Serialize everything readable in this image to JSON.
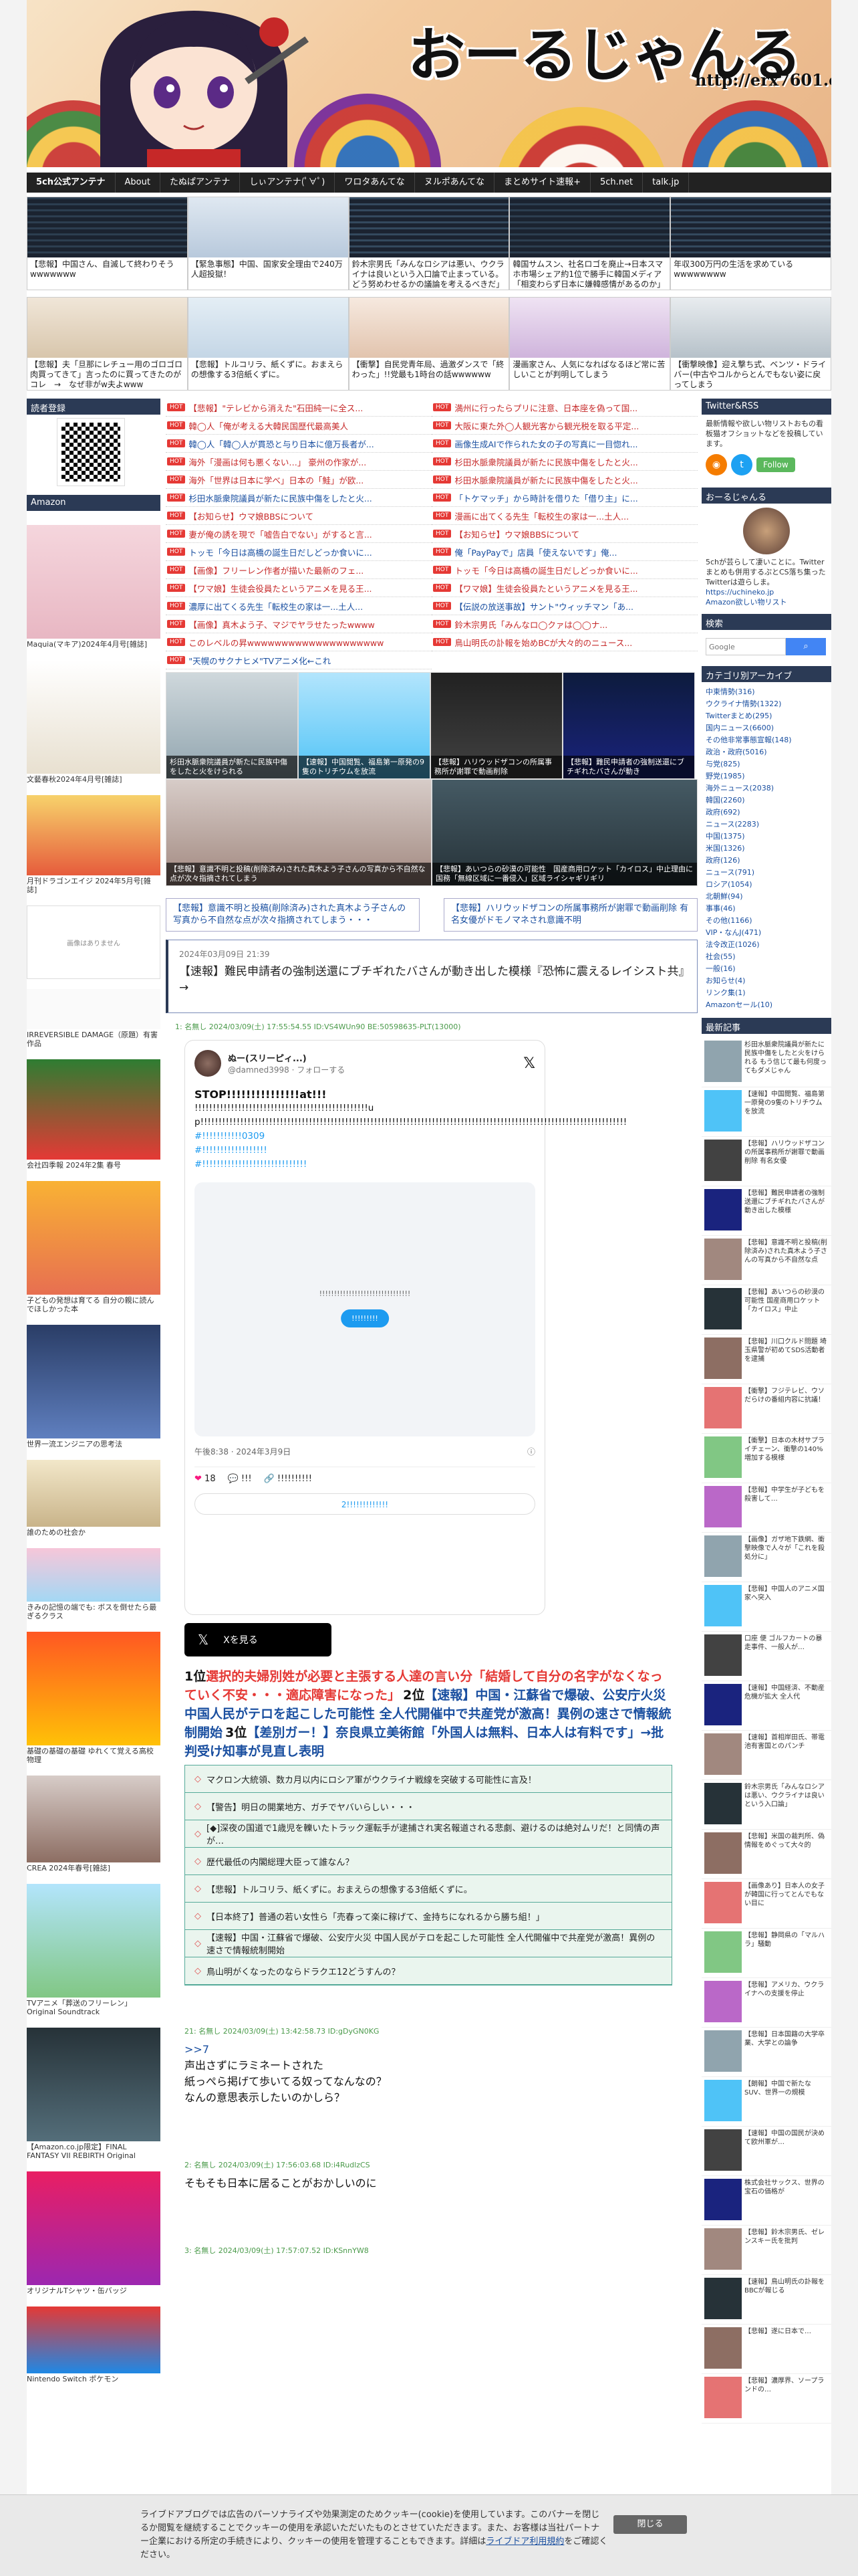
{
  "site": {
    "title": "おーるじゃんる",
    "url": "http://erx7601.com"
  },
  "nav": [
    "5ch公式アンテナ",
    "About",
    "たぬぱアンテナ",
    "しぃアンテナ(ﾟ∀ﾟ)",
    "ワロタあんてな",
    "ヌルポあんてな",
    "まとめサイト速報+",
    "5ch.net",
    "talk.jp"
  ],
  "top_thumbs": [
    "【悲報】中国さん、自滅して終わりそうwwwwwww",
    "【緊急事態】中国、国家安全理由で240万人超投獄！",
    "鈴木宗男氏「みんなロシアは悪い、ウクライナは良いという入口論で止まっている。どう努めわせるかの議論を考えるべきだ」",
    "韓国サムスン、社名ロゴを廃止→日本スマホ市場シェア約1位で勝手に韓国メディア「相変わらず日本に嫌韓感情があるのか」",
    "年収300万円の生活を求めているwwwwwwww",
    "【悲報】夫「旦那にレチュー用のゴロゴロ肉買ってきて」言ったのに買ってきたのがコレ　→　なぜ非がw夫よwww",
    "【悲報】トルコリラ、紙くずに。おまえらの想像する3倍紙くずに。",
    "【衝撃】自民党青年局、過激ダンスで「終わった」!!党最も1時台の話wwwwww",
    "漫画家さん、人気になればなるほど常に苦しいことが判明してしまう",
    "【衝撃映像】迎え撃ち式、ベンツ・ドライバー(中古やコルからとんでもない姿に戻ってしまう"
  ],
  "left": {
    "reader_title": "読者登録",
    "amazon_title": "Amazon",
    "ads": [
      "Maquia(マキア)2024年4月号[雑誌]",
      "文藝春秋2024年4月号[雑誌]",
      "月刊ドラゴンエイジ 2024年5月号[雑誌]",
      "画像はありません",
      "IRREVERSIBLE DAMAGE（原題）有害作品",
      "会社四季報 2024年2集 春号",
      "子どもの発想は育てる 自分の親に読んでほしかった本",
      "世界一流エンジニアの思考法",
      "誰のための社会か",
      "きみの記憶の端でも: ボスを倒せたら最ぎるクラス",
      "基礎の基礎の基礎 ゆれくて覚える高校物理",
      "CREA 2024年春号[雑誌]",
      "TVアニメ「葬送のフリーレン」Original Soundtrack",
      "【Amazon.co.jp限定】FINAL FANTASY VII REBIRTH Original",
      "オリジナルTシャツ・缶バッジ",
      "Nintendo Switch ポケモン"
    ]
  },
  "headlines_left": [
    "【悲報】\"テレビから消えた\"石田純一に全ス...",
    "韓◯人「俺が考える大韓民国歴代最高美人",
    "韓◯人「韓◯人が貫恐と与り日本に億万長者が...",
    "海外「漫画は何も悪くない…」 豪州の作家が...",
    "海外「世界は日本に学べ」日本の「鮭」が欧...",
    "杉田水脈衆院議員が新たに民族中傷をしたと火...",
    "【お知らせ】ウマ娘BBSについて",
    "妻が俺の誘を現で「嘘告白でない」がすると言...",
    "トッモ「今日は高橋の誕生日だしどっか食いに...",
    "【画像】フリーレン作者が描いた最新のフェ...",
    "【ワマ娘】生徒会役員たというアニメを見る王...",
    "濃厚に出てくる先生「転校生の家は一...土人...",
    "【画像】真木よう子、マジでヤラせたったwwww",
    "このレベルの昇wwwwwwwwwwwwwwwwwwww",
    "\"天幌のサクナヒメ\"TVアニメ化←これ"
  ],
  "headlines_right": [
    "満州に行ったらプリに注意、日本座を偽って国...",
    "大阪に東た外◯人観光客から観光税を取る平定...",
    "画像生成AIで作られた女の子の写真に一目惚れ...",
    "杉田水脈衆院議員が新たに民族中傷をしたと火...",
    "杉田水脈衆院議員が新たに民族中傷をしたと火...",
    "「トケマッチ」から時計を借りた「借り主」に...",
    "漫画に出てくる先生「転校生の家は一...土人...",
    "【お知らせ】ウマ娘BBSについて",
    "俺「PayPayで」店員「使えないです」俺...",
    "トッモ「今日は高橋の誕生日だしどっか食いに...",
    "【ワマ娘】生徒会役員たというアニメを見る王...",
    "【伝説の放送事故】サント\"ウィッチマン「あ...",
    "鈴木宗男氏「みんなロ◯クァは◯◯ナ...",
    "鳥山明氏の訃報を始めBCが大々的のニュース..."
  ],
  "photo_grid": [
    "杉田水脈衆院議員が新たに民族中傷をしたと火をけられる",
    "【速報】中国閲覧、福島第一原発の9隻のトリチウムを放流",
    "【悲報】ハリウッドザコンの所属事務所が謝罪で動画削除",
    "【悲報】難民申請者の強制送還にブチギれたバさんが動き",
    "【悲報】意識不明と投稿(削除済み)された真木よう子さんの写真から不自然な点が次々指摘されてしまう",
    "【悲報】あいつらの砂漠の可能性　国産商用ロケット「カイロス」中止理由に国務「無線区域に一番侵入」区域ライシャギリギリ"
  ],
  "prev_next": {
    "prev": "【悲報】意識不明と投稿(削除済み)された真木よう子さんの写真から不自然な点が次々指摘されてしまう・・・",
    "next": "【悲報】ハリウッドザコンの所属事務所が謝罪で動画削除 有名女優がドモノマネされ意識不明"
  },
  "article": {
    "date": "2024年03月09日 21:39",
    "title": "【速報】難民申請者の強制送還にブチギれたバさんが動き出した模様『恐怖に震えるレイシスト共』→"
  },
  "post1": {
    "head": "1: 名無し 2024/03/09(土) 17:55:54.55 ID:VS4WUn90 BE:50598635-PLT(13000)",
    "tweet_name": "ぬー(スリーピィ...)",
    "tweet_handle": "@damned3998 · フォローする",
    "tweet_title": "STOP!!!!!!!!!!!!!!!at!!!",
    "tweet_body": "!!!!!!!!!!!!!!!!!!!!!!!!!!!!!!!!!!!!!!!!!!!!!!!!up!!!!!!!!!!!!!!!!!!!!!!!!!!!!!!!!!!!!!!!!!!!!!!!!!!!!!!!!!!!!!!!!!!!!!!!!!!!!!!!!!!!!!!!!!!!!!!!!!!!!!!!!!!!!!!!!!!!!!!",
    "hashtags": [
      "#!!!!!!!!!!!0309",
      "#!!!!!!!!!!!!!!!!!!",
      "#!!!!!!!!!!!!!!!!!!!!!!!!!!!!!"
    ],
    "media_msg": "!!!!!!!!!!!!!!!!!!!!!!!!!!!!!!!",
    "media_btn": "!!!!!!!!!",
    "tweet_time": "午後8:38 · 2024年3月9日",
    "likes": "18",
    "reply_label": "!!!",
    "link_label": "!!!!!!!!!!",
    "read_more": "2!!!!!!!!!!!!!",
    "x_btn": "Xを見る"
  },
  "ranking": [
    {
      "no": "1位",
      "text": "選択的夫婦別姓が必要と主張する人達の言い分「結婚して自分の名字がなくなっていく不安・・・適応障害になった」"
    },
    {
      "no": "2位",
      "text": "【速報】中国・江蘇省で爆破、公安庁火災 中国人民がテロを起こした可能性 全人代開催中で共産党が激高！異例の速さで情報統制開始"
    },
    {
      "no": "3位",
      "text": "【差別ガー！】奈良県立美術館「外国人は無料、日本人は有料です」→批判受け知事が見直し表明"
    }
  ],
  "linklist": [
    "マクロン大統領、数カ月以内にロシア軍がウクライナ戦線を突破する可能性に言及！",
    "【警告】明日の開業地方、ガチでヤバいらしい・・・",
    "[◆]深夜の国道で1歳児を轢いたトラック運転手が逮捕され実名報道される悲劇、避けるのは絶対ムリだ！と同情の声が…",
    "歴代最低の内閣総理大臣って誰なん？",
    "【悲報】トルコリラ、紙くずに。おまえらの想像する3倍紙くずに。",
    "【日本終了】普通の若い女性ら「売春って楽に稼げて、金持ちになれるから勝ち組！」",
    "【速報】中国・江蘇省で爆破、公安庁火災 中国人民がテロを起こした可能性 全人代開催中で共産党が激高！異例の速さで情報統制開始",
    "鳥山明がくなったのならドラクエ12どうすんの？"
  ],
  "comments": [
    {
      "head": "21: 名無し 2024/03/09(土) 13:42:58.73 ID:gDyGN0KG",
      "quote": ">>7",
      "body": "声出さずにラミネートされた\n紙っぺら掲げて歩いてる奴ってなんなの？\nなんの意思表示したいのかしら？"
    },
    {
      "head": "2: 名無し 2024/03/09(土) 17:56:03.68 ID:i4RudlzCS",
      "quote": "",
      "body": "そもそも日本に居ることがおかしいのに"
    },
    {
      "head": "3: 名無し 2024/03/09(土) 17:57:07.52 ID:KSnnYW8",
      "quote": "",
      "body": ""
    }
  ],
  "right": {
    "twitter_title": "Twitter&RSS",
    "twitter_text": "最新情報や欲しい物リストおもの看板猫オフショットなどを投稿しています。",
    "follow": "Follow",
    "about_title": "おーるじゃんる",
    "about_text": "5chが芸らして凄いことに。Twitterまとめも併用するぷとCS落ち集ったTwitterは遊らしま。",
    "about_link": "https://uchineko.jp",
    "about_link2": "Amazon欲しい物リスト",
    "search_title": "検索",
    "search_placeholder": "Google",
    "cat_title": "カテゴリ別アーカイブ",
    "categories": [
      "中東情勢(316)",
      "ウクライナ情勢(1322)",
      "Twitterまとめ(295)",
      "国内ニュース(6600)",
      "その他非常事態宣報(148)",
      "政治・政府(5016)",
      "与党(825)",
      "野党(1985)",
      "海外ニュース(2038)",
      "韓国(2260)",
      "政府(692)",
      "ニュース(2283)",
      "中国(1375)",
      "米国(1326)",
      "政府(126)",
      "ニュース(791)",
      "ロシア(1054)",
      "北朝鮮(94)",
      "事事(46)",
      "その他(1166)",
      "VIP・なんJ(471)",
      "法令改正(1026)",
      "社会(55)",
      "一般(16)",
      "お知らせ(4)",
      "リンク集(1)",
      "Amazonセール(10)"
    ],
    "recent_title": "最新記事",
    "recent": [
      "杉田水脈衆院議員が新たに民族中傷をしたと火をけられる もう信じて最も何度ってもダメじゃん",
      "【速報】中国閲覧、福島第一原発の9隻のトリチウムを放流",
      "【悲報】ハリウッドザコンの所属事務所が謝罪で動画削除 有名女優",
      "【悲報】難民申請者の強制送還にブチギれたバさんが動き出した模様",
      "【悲報】意識不明と投稿(削除済み)された真木よう子さんの写真から不自然な点",
      "【悲報】あいつらの砂漠の可能性 国産商用ロケット「カイロス」中止",
      "【悲報】川口クルド問題 埼玉県警が初めてSDS活動者を逮捕",
      "【衝撃】フジテレビ、ウソだらけの番組内容に抗議！",
      "【衝撃】日本の木材サプライチェーン、衝撃の140%増加する模様",
      "【悲報】中学生が子どもを殺害して…",
      "【画像】ガザ地下鉄網、衝撃映像で人々が「これを殺処分に」",
      "【悲報】中国人のアニメ国家へ突入",
      "口座 便 ゴルフカートの暴走事件、一般人が…",
      "【速報】中国経済、不動産危機が拡大 全人代",
      "【速報】首相岸田氏、帯電池有害国とのパンチ",
      "鈴木宗男氏「みんなロシアは悪い、ウクライナは良いという入口論」",
      "【悲報】米国の裁判所、偽情報をめぐって大々的",
      "【画像あり】日本人の女子が韓国に行ってとんでもない目に",
      "【悲報】静岡県の「マルハラ」騒動",
      "【悲報】アメリカ、ウクライナへの支援を停止",
      "【悲報】日本国籍の大学卒業、大学との論争",
      "【朗報】中国で新たなSUV、世界一の規模",
      "【速報】中国の国民が決めて欧州軍が…",
      "株式会社サックス、世界の宝石の価格が",
      "【悲報】鈴木宗男氏、ゼレンスキー氏を批判",
      "【速報】鳥山明氏の訃報をBBCが報じる",
      "【悲報】遂に日本で…",
      "【悲報】濃厚界、ソープランドの…"
    ]
  },
  "cookie": {
    "text": "ライブドアブログでは広告のパーソナライズや効果測定のためクッキー(cookie)を使用しています。このバナーを閉じるか閲覧を継続することでクッキーの使用を承認いただいたものとさせていただきます。また、お客様は当社パートナー企業における所定の手続きにより、クッキーの使用を管理することもできます。詳細は",
    "link": "ライブドア利用規約",
    "tail": "をご確認ください。",
    "button": "閉じる"
  }
}
